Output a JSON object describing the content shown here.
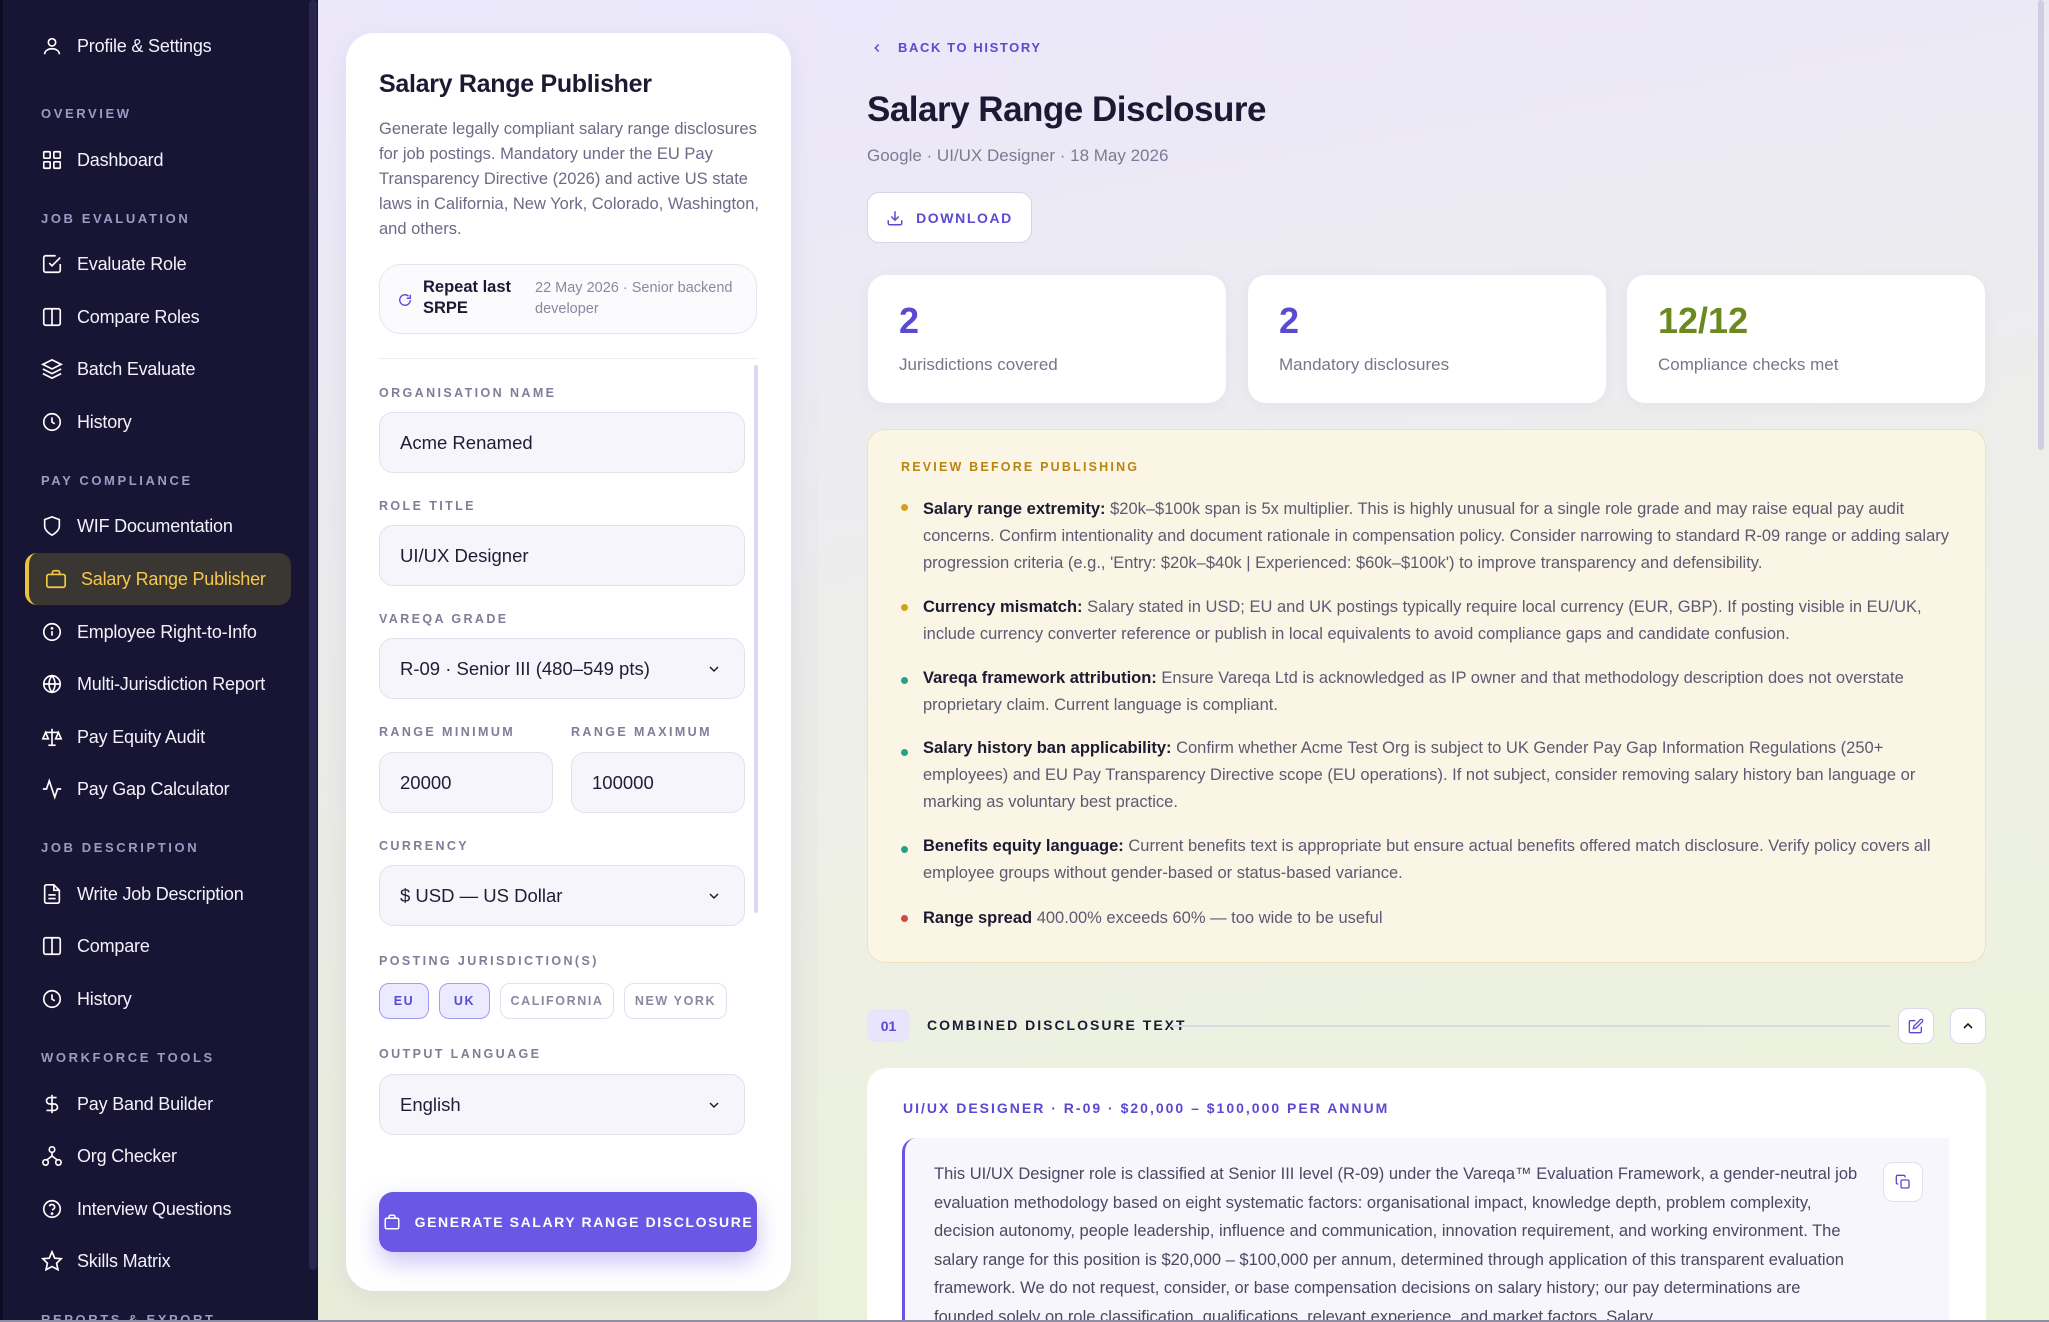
{
  "sidebar": {
    "profile": "Profile & Settings",
    "sections": [
      {
        "title": "OVERVIEW"
      },
      {
        "title": "JOB EVALUATION"
      },
      {
        "title": "PAY COMPLIANCE"
      },
      {
        "title": "JOB DESCRIPTION"
      },
      {
        "title": "WORKFORCE TOOLS"
      },
      {
        "title": "REPORTS & EXPORT"
      }
    ],
    "items": [
      {
        "label": "Dashboard",
        "icon": "grid-icon"
      },
      {
        "label": "Evaluate Role",
        "icon": "check-square-icon"
      },
      {
        "label": "Compare Roles",
        "icon": "columns-icon"
      },
      {
        "label": "Batch Evaluate",
        "icon": "layers-icon"
      },
      {
        "label": "History",
        "icon": "clock-icon"
      },
      {
        "label": "WIF Documentation",
        "icon": "shield-icon"
      },
      {
        "label": "Salary Range Publisher",
        "icon": "briefcase-icon",
        "active": true
      },
      {
        "label": "Employee Right-to-Info",
        "icon": "info-icon"
      },
      {
        "label": "Multi-Jurisdiction Report",
        "icon": "globe-icon"
      },
      {
        "label": "Pay Equity Audit",
        "icon": "scale-icon"
      },
      {
        "label": "Pay Gap Calculator",
        "icon": "activity-icon"
      },
      {
        "label": "Write Job Description",
        "icon": "file-text-icon"
      },
      {
        "label": "Compare",
        "icon": "columns-icon"
      },
      {
        "label": "History",
        "icon": "clock-icon"
      },
      {
        "label": "Pay Band Builder",
        "icon": "dollar-icon"
      },
      {
        "label": "Org Checker",
        "icon": "org-chart-icon"
      },
      {
        "label": "Interview Questions",
        "icon": "help-circle-icon"
      },
      {
        "label": "Skills Matrix",
        "icon": "star-icon"
      }
    ]
  },
  "form": {
    "title": "Salary Range Publisher",
    "description": "Generate legally compliant salary range disclosures for job postings. Mandatory under the EU Pay Transparency Directive (2026) and active US state laws in California, New York, Colorado, Washington, and others.",
    "repeat_label": "Repeat last SRPE",
    "repeat_meta": "22 May 2026 · Senior backend developer",
    "org_label": "ORGANISATION NAME",
    "org_value": "Acme Renamed",
    "role_label": "ROLE TITLE",
    "role_value": "UI/UX Designer",
    "grade_label": "VAREQA GRADE",
    "grade_value": "R-09 · Senior III (480–549 pts)",
    "min_label": "RANGE MINIMUM",
    "min_value": "20000",
    "max_label": "RANGE MAXIMUM",
    "max_value": "100000",
    "currency_label": "CURRENCY",
    "currency_value": "$ USD — US Dollar",
    "jurisdiction_label": "POSTING JURISDICTION(S)",
    "jurisdictions": [
      {
        "label": "EU",
        "selected": true
      },
      {
        "label": "UK",
        "selected": true
      },
      {
        "label": "CALIFORNIA",
        "selected": false
      },
      {
        "label": "NEW YORK",
        "selected": false
      }
    ],
    "language_label": "OUTPUT LANGUAGE",
    "language_value": "English",
    "generate_label": "GENERATE SALARY RANGE DISCLOSURE"
  },
  "main": {
    "back_label": "BACK TO HISTORY",
    "title": "Salary Range Disclosure",
    "meta": "Google · UI/UX Designer · 18 May 2026",
    "download_label": "DOWNLOAD",
    "stats": [
      {
        "value": "2",
        "caption": "Jurisdictions covered",
        "color": "#5a4ad2"
      },
      {
        "value": "2",
        "caption": "Mandatory disclosures",
        "color": "#5a4ad2"
      },
      {
        "value": "12/12",
        "caption": "Compliance checks met",
        "color": "#6a8a1f"
      }
    ],
    "review": {
      "title": "REVIEW BEFORE PUBLISHING",
      "items": [
        {
          "head": "Salary range extremity:",
          "text": " $20k–$100k span is 5x multiplier. This is highly unusual for a single role grade and may raise equal pay audit concerns. Confirm intentionality and document rationale in compensation policy. Consider narrowing to standard R-09 range or adding salary progression criteria (e.g., 'Entry: $20k–$40k | Experienced: $60k–$100k') to improve transparency and defensibility.",
          "color": "#d6a019"
        },
        {
          "head": "Currency mismatch:",
          "text": " Salary stated in USD; EU and UK postings typically require local currency (EUR, GBP). If posting visible in EU/UK, include currency converter reference or publish in local equivalents to avoid compliance gaps and candidate confusion.",
          "color": "#d6a019"
        },
        {
          "head": "Vareqa framework attribution:",
          "text": " Ensure Vareqa Ltd is acknowledged as IP owner and that methodology description does not overstate proprietary claim. Current language is compliant.",
          "color": "#22a38a"
        },
        {
          "head": "Salary history ban applicability:",
          "text": " Confirm whether Acme Test Org is subject to UK Gender Pay Gap Information Regulations (250+ employees) and EU Pay Transparency Directive scope (EU operations). If not subject, consider removing salary history ban language or marking as voluntary best practice.",
          "color": "#22a38a"
        },
        {
          "head": "Benefits equity language:",
          "text": " Current benefits text is appropriate but ensure actual benefits offered match disclosure. Verify policy covers all employee groups without gender-based or status-based variance.",
          "color": "#22a38a"
        },
        {
          "head": "Range spread",
          "text": " 400.00% exceeds 60% — too wide to be useful",
          "color": "#d34a3a"
        }
      ]
    },
    "section": {
      "number": "01",
      "title": "COMBINED DISCLOSURE TEXT"
    },
    "card": {
      "title": "UI/UX DESIGNER · R-09 · $20,000 – $100,000 PER ANNUM",
      "body": "This UI/UX Designer role is classified at Senior III level (R-09) under the Vareqa™ Evaluation Framework, a gender-neutral job evaluation methodology based on eight systematic factors: organisational impact, knowledge depth, problem complexity, decision autonomy, people leadership, influence and communication, innovation requirement, and working environment. The salary range for this position is $20,000 – $100,000 per annum, determined through application of this transparent evaluation framework. We do not request, consider, or base compensation decisions on salary history; our pay determinations are founded solely on role classification, qualifications, relevant experience, and market factors. Salary"
    }
  }
}
